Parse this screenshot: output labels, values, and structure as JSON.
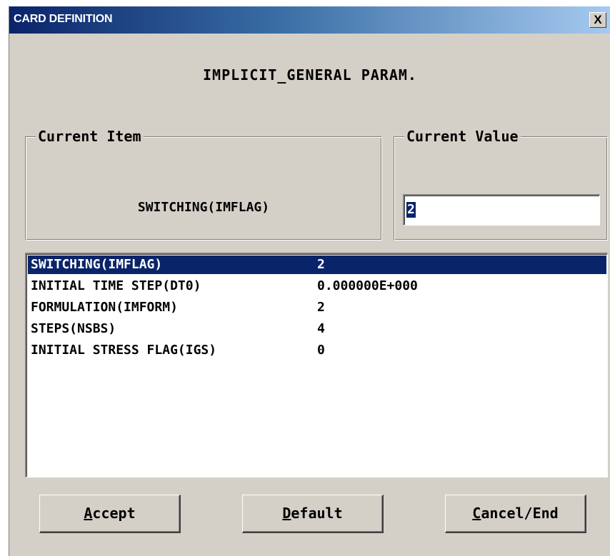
{
  "window": {
    "title": "CARD DEFINITION",
    "close_glyph": "X"
  },
  "heading": "IMPLICIT_GENERAL PARAM.",
  "current_item": {
    "label": "Current Item",
    "value": "SWITCHING(IMFLAG)"
  },
  "current_value": {
    "label": "Current Value",
    "value": "2"
  },
  "list": {
    "rows": [
      {
        "name": "SWITCHING(IMFLAG)",
        "value": "2",
        "selected": true
      },
      {
        "name": "INITIAL TIME STEP(DT0)",
        "value": "0.000000E+000",
        "selected": false
      },
      {
        "name": "FORMULATION(IMFORM)",
        "value": "2",
        "selected": false
      },
      {
        "name": "STEPS(NSBS)",
        "value": "4",
        "selected": false
      },
      {
        "name": "INITIAL STRESS FLAG(IGS)",
        "value": "0",
        "selected": false
      }
    ]
  },
  "buttons": {
    "accept": {
      "mnemonic": "A",
      "rest": "ccept"
    },
    "default": {
      "mnemonic": "D",
      "rest": "efault"
    },
    "cancel": {
      "mnemonic": "C",
      "rest": "ancel/End"
    }
  },
  "colors": {
    "title_start": "#0a246a",
    "title_end": "#a6caf0",
    "selection": "#0a246a",
    "face": "#d4d0c8"
  }
}
